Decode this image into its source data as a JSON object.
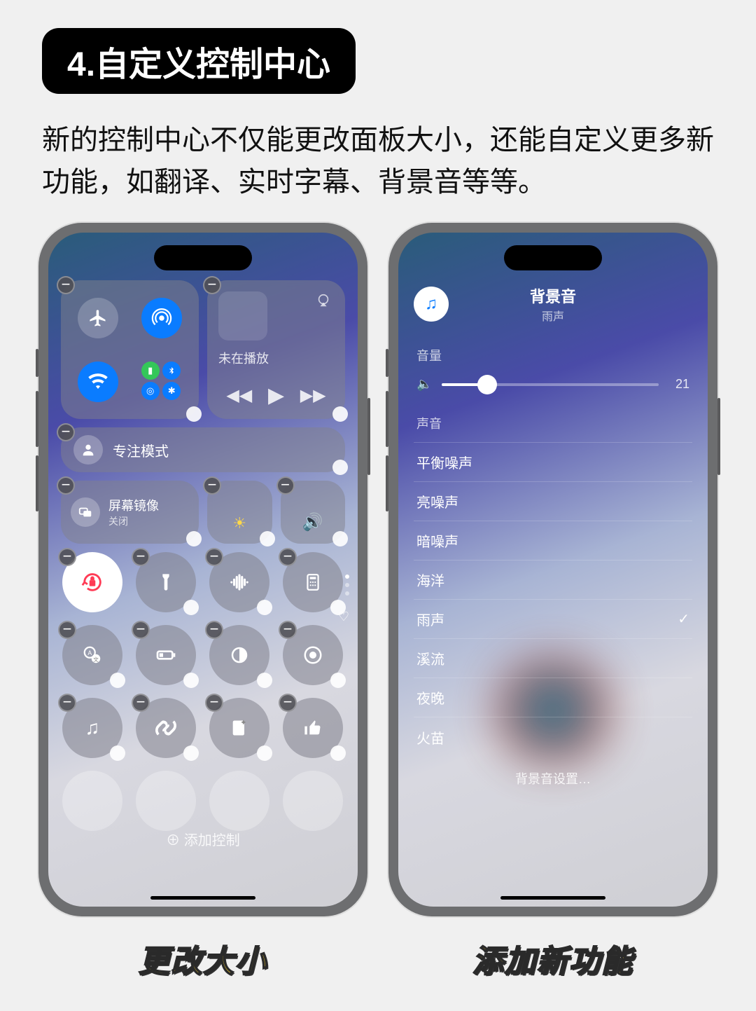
{
  "heading": "4.自定义控制中心",
  "description": "新的控制中心不仅能更改面板大小，还能自定义更多新功能，如翻译、实时字幕、背景音等等。",
  "left_phone": {
    "media": {
      "not_playing": "未在播放"
    },
    "focus": {
      "label": "专注模式"
    },
    "mirror": {
      "title": "屏幕镜像",
      "sub": "关闭"
    },
    "add_control": "添加控制"
  },
  "right_phone": {
    "header": {
      "title": "背景音",
      "subtitle": "雨声"
    },
    "volume": {
      "section": "音量",
      "value": "21",
      "percent": 21
    },
    "sound_section": "声音",
    "sounds": [
      "平衡噪声",
      "亮噪声",
      "暗噪声",
      "海洋",
      "雨声",
      "溪流",
      "夜晚",
      "火苗"
    ],
    "selected_sound": "雨声",
    "settings_link": "背景音设置…"
  },
  "captions": {
    "left": "更改大小",
    "right": "添加新功能"
  }
}
